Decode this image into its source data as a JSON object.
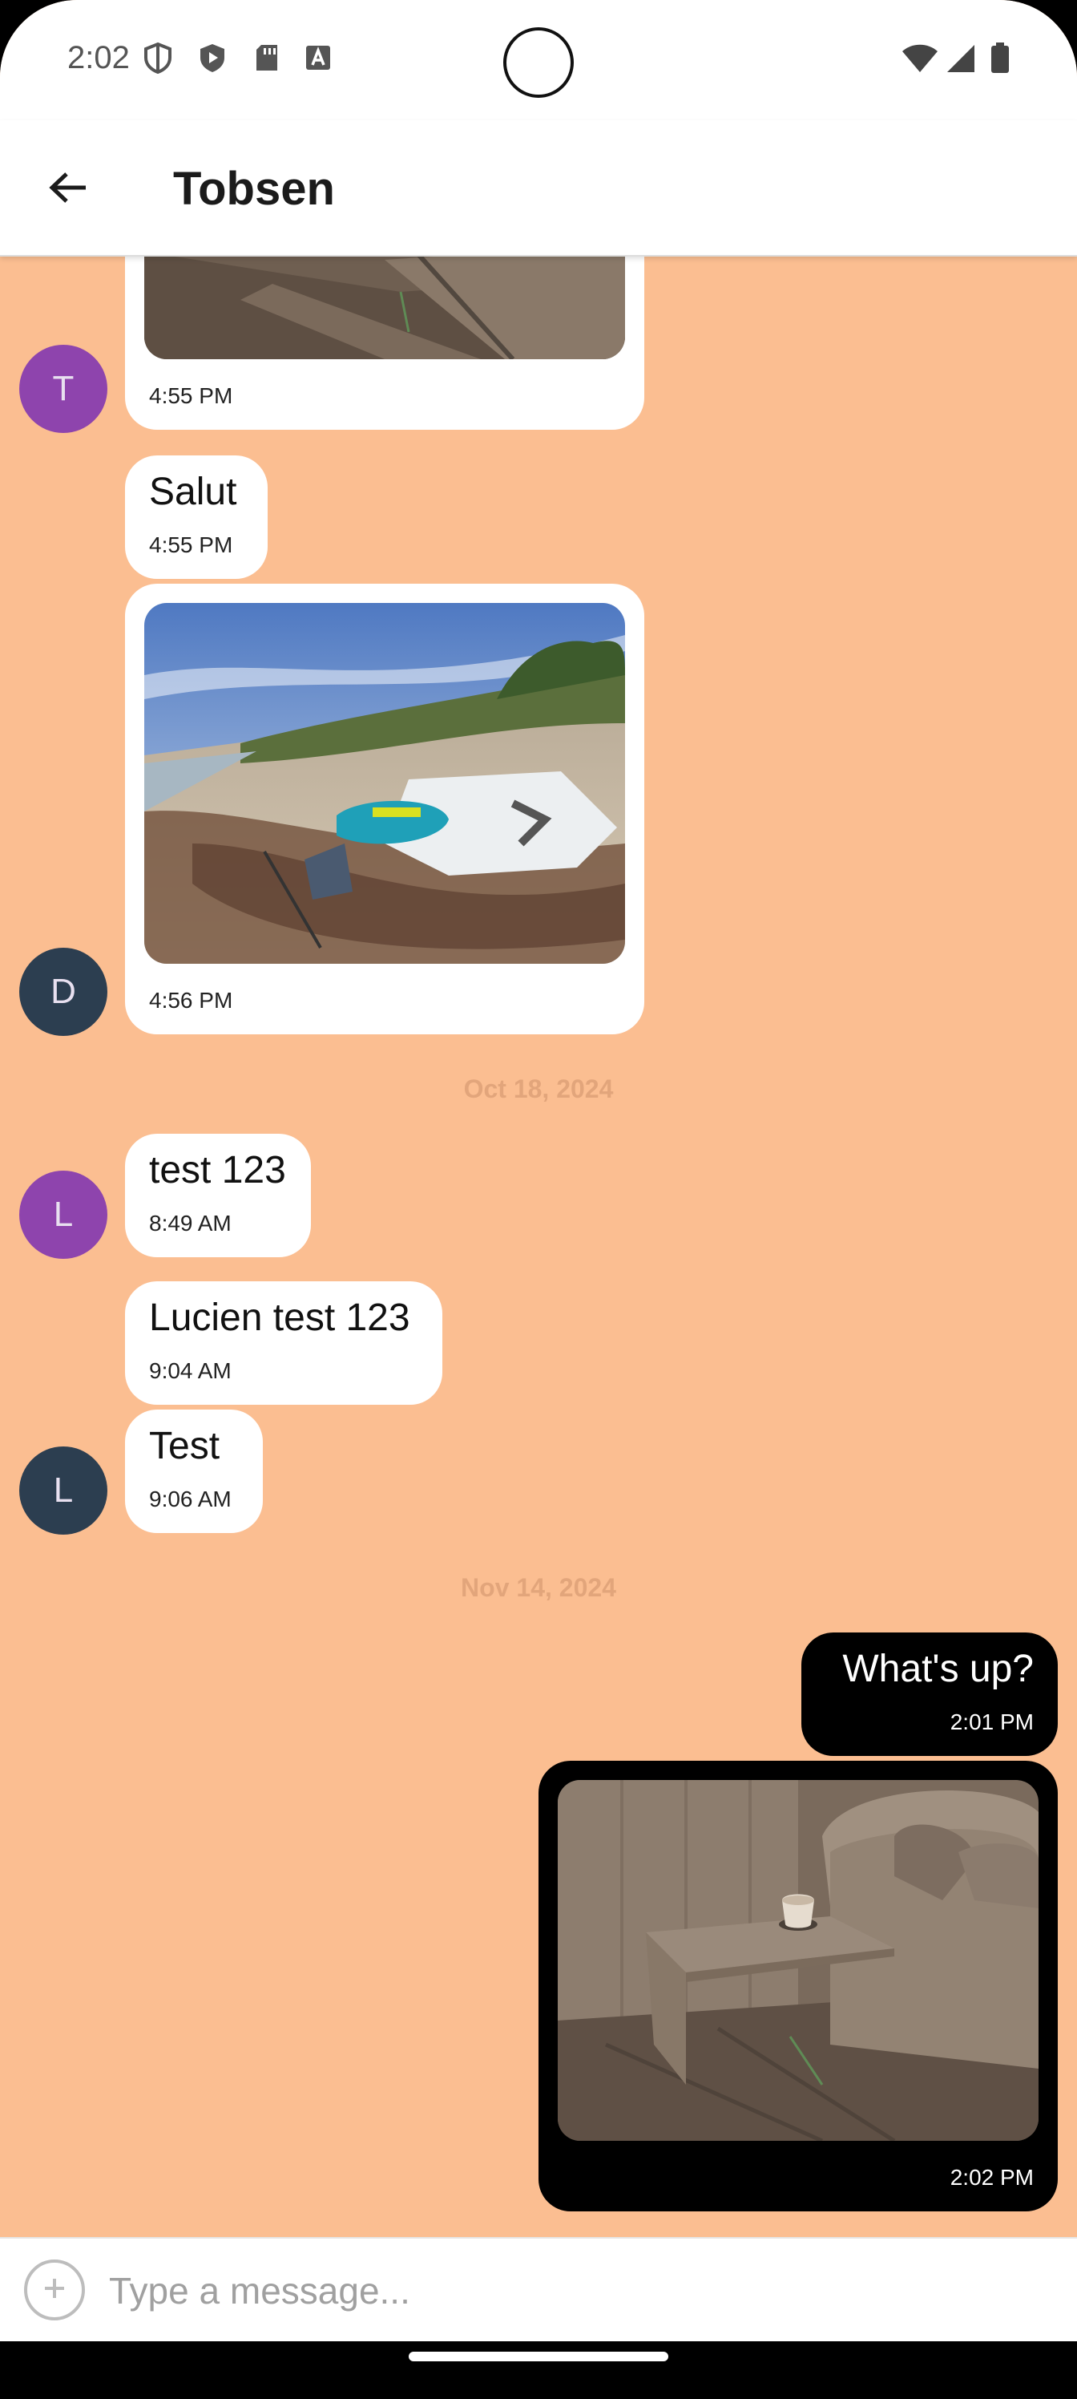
{
  "status_bar": {
    "time": "2:02",
    "icons_left": [
      "shield-outline-icon",
      "shield-play-icon",
      "sd-card-icon",
      "keyboard-a-icon"
    ],
    "icons_right": [
      "wifi-icon",
      "signal-icon",
      "battery-icon"
    ]
  },
  "header": {
    "back_icon": "arrow-left-icon",
    "title": "Tobsen"
  },
  "messages": [
    {
      "type": "image",
      "sender_initial": "T",
      "avatar_color": "#8E44AD",
      "time": "4:55 PM",
      "image_desc": "interior-room"
    },
    {
      "type": "text",
      "text": "Salut",
      "time": "4:55 PM"
    },
    {
      "type": "image",
      "sender_initial": "D",
      "avatar_color": "#2C3E50",
      "time": "4:56 PM",
      "image_desc": "beach-kite"
    },
    {
      "type": "date",
      "text": "Oct 18, 2024"
    },
    {
      "type": "text",
      "sender_initial": "L",
      "avatar_color": "#8E44AD",
      "text": "test 123",
      "time": "8:49 AM"
    },
    {
      "type": "text",
      "text": "Lucien test 123",
      "time": "9:04 AM"
    },
    {
      "type": "text",
      "sender_initial": "L",
      "avatar_color": "#2C3E50",
      "text": "Test",
      "time": "9:06 AM"
    },
    {
      "type": "date",
      "text": "Nov 14, 2024"
    },
    {
      "type": "text",
      "own": true,
      "text": "What's up?",
      "time": "2:01 PM"
    },
    {
      "type": "image",
      "own": true,
      "time": "2:02 PM",
      "image_desc": "interior-room"
    }
  ],
  "composer": {
    "add_icon": "plus-circle-icon",
    "placeholder": "Type a message...",
    "value": ""
  },
  "colors": {
    "chat_background": "#FBBE91",
    "incoming_bubble": "#FFFFFF",
    "outgoing_bubble": "#000000",
    "date_separator": "#E2A57B"
  }
}
